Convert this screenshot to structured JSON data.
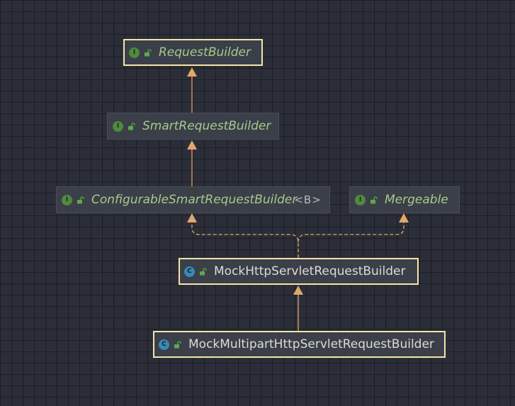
{
  "diagram": {
    "type": "class-hierarchy",
    "colors": {
      "background": "#2b2e38",
      "node_fill": "#3b3f49",
      "selected_border": "#f5e4a8",
      "edge": "#e0a868",
      "interface_text": "#a8c98a",
      "class_text": "#dddbd4"
    },
    "nodes": [
      {
        "id": "rb",
        "name": "RequestBuilder",
        "kind": "interface",
        "kind_letter": "I",
        "selected": true
      },
      {
        "id": "srb",
        "name": "SmartRequestBuilder",
        "kind": "interface",
        "kind_letter": "I",
        "selected": false
      },
      {
        "id": "csrb",
        "name": "ConfigurableSmartRequestBuilder",
        "generic": "<B>",
        "kind": "interface",
        "kind_letter": "I",
        "selected": false
      },
      {
        "id": "merg",
        "name": "Mergeable",
        "kind": "interface",
        "kind_letter": "I",
        "selected": false
      },
      {
        "id": "mhs",
        "name": "MockHttpServletRequestBuilder",
        "kind": "class",
        "kind_letter": "C",
        "selected": true
      },
      {
        "id": "mmp",
        "name": "MockMultipartHttpServletRequestBuilder",
        "kind": "class",
        "kind_letter": "C",
        "selected": true
      }
    ],
    "edges": [
      {
        "from": "srb",
        "to": "rb",
        "relation": "extends",
        "style": "solid"
      },
      {
        "from": "csrb",
        "to": "srb",
        "relation": "extends",
        "style": "solid"
      },
      {
        "from": "mhs",
        "to": "csrb",
        "relation": "implements",
        "style": "dashed"
      },
      {
        "from": "mhs",
        "to": "merg",
        "relation": "implements",
        "style": "dashed"
      },
      {
        "from": "mmp",
        "to": "mhs",
        "relation": "extends",
        "style": "solid"
      }
    ]
  }
}
